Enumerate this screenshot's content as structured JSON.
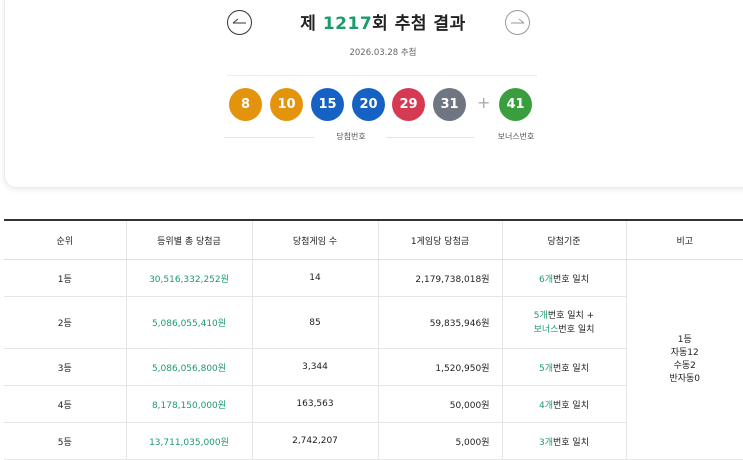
{
  "draw": {
    "title_prefix": "제 ",
    "round": "1217",
    "title_suffix": "회 추첨 결과",
    "date": "2026.03.28 추첨",
    "numbers": [
      "8",
      "10",
      "15",
      "20",
      "29",
      "31"
    ],
    "number_colors": [
      "#e3930c",
      "#e3930c",
      "#1662c4",
      "#1662c4",
      "#d63a52",
      "#6f7581"
    ],
    "plus": "+",
    "bonus": "41",
    "bonus_color": "#3a9e3e",
    "winning_label": "당첨번호",
    "bonus_label": "보너스번호",
    "prev_icon": "arrow-left-icon",
    "next_icon": "arrow-right-icon"
  },
  "table": {
    "headers": [
      "순위",
      "등위별 총 당첨금",
      "당첨게임 수",
      "1게임당 당첨금",
      "당첨기준",
      "비고"
    ],
    "rows": [
      {
        "rank": "1등",
        "total": "30,516,332,252원",
        "games": "14",
        "per_game": "2,179,738,018원",
        "crit_a_num": "6개",
        "crit_a_text": "번호 일치",
        "crit_b_num": "",
        "crit_b_text": ""
      },
      {
        "rank": "2등",
        "total": "5,086,055,410원",
        "games": "85",
        "per_game": "59,835,946원",
        "crit_a_num": "5개",
        "crit_a_text": "번호 일치 +",
        "crit_b_num": "보너스",
        "crit_b_text": "번호 일치"
      },
      {
        "rank": "3등",
        "total": "5,086,056,800원",
        "games": "3,344",
        "per_game": "1,520,950원",
        "crit_a_num": "5개",
        "crit_a_text": "번호 일치",
        "crit_b_num": "",
        "crit_b_text": ""
      },
      {
        "rank": "4등",
        "total": "8,178,150,000원",
        "games": "163,563",
        "per_game": "50,000원",
        "crit_a_num": "4개",
        "crit_a_text": "번호 일치",
        "crit_b_num": "",
        "crit_b_text": ""
      },
      {
        "rank": "5등",
        "total": "13,711,035,000원",
        "games": "2,742,207",
        "per_game": "5,000원",
        "crit_a_num": "3개",
        "crit_a_text": "번호 일치",
        "crit_b_num": "",
        "crit_b_text": ""
      }
    ],
    "remark": [
      "1등",
      "자동12",
      "수동2",
      "반자동0"
    ]
  }
}
